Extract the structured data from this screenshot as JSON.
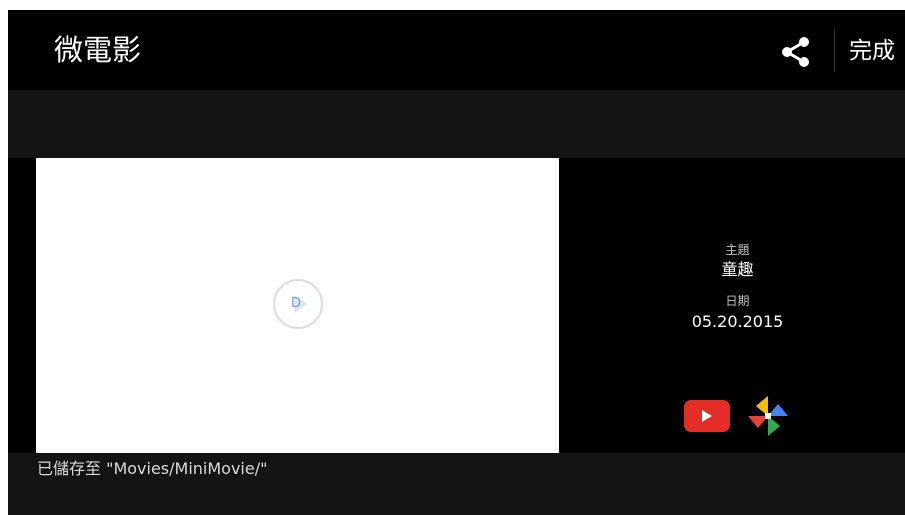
{
  "header": {
    "title": "微電影",
    "share_icon": "share-icon",
    "done_label": "完成"
  },
  "preview": {
    "play_icon": "play-icon",
    "play_glyph": "D"
  },
  "info": {
    "theme_label": "主題",
    "theme_value": "童趣",
    "date_label": "日期",
    "date_value": "05.20.2015",
    "upload_targets": [
      "youtube-icon",
      "google-photos-icon"
    ]
  },
  "footer": {
    "save_message": "已儲存至 \"Movies/MiniMovie/\""
  },
  "colors": {
    "background": "#000000",
    "band": "#141414",
    "youtube_red": "#e52d27"
  }
}
